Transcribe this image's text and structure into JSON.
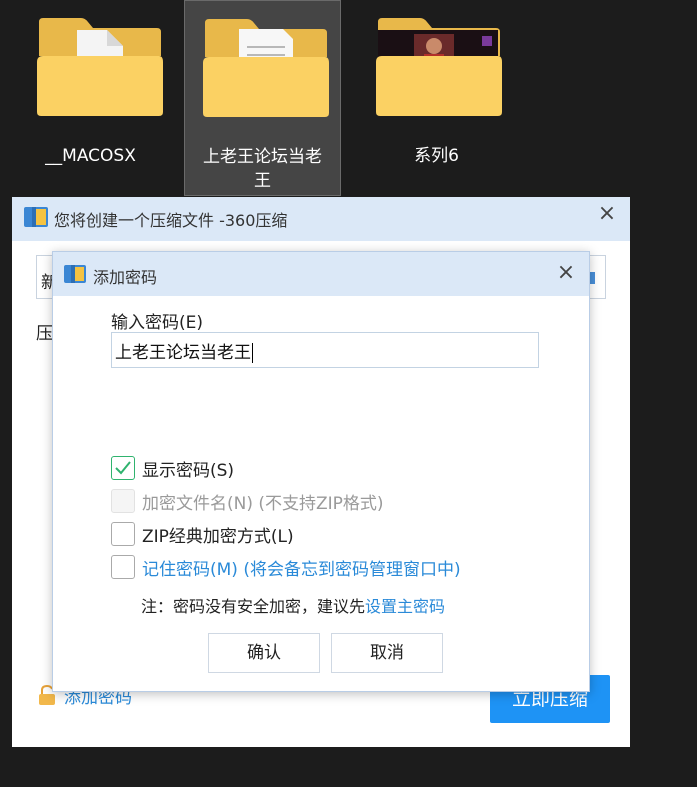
{
  "desktop": {
    "folders": [
      {
        "label": "__MACOSX",
        "icon": "folder-document-icon",
        "selected": false
      },
      {
        "label": "上老王论坛当老王",
        "icon": "folder-document-icon",
        "selected": true
      },
      {
        "label": "系列6",
        "icon": "folder-photo-icon",
        "selected": false
      }
    ]
  },
  "outer_dialog": {
    "title": "您将创建一个压缩文件 -360压缩",
    "close_icon": "×",
    "name_input_value": "新",
    "compress_label": "压",
    "add_password_label": "添加密码",
    "compress_button": "立即压缩"
  },
  "password_dialog": {
    "title": "添加密码",
    "close_icon": "×",
    "password_label": "输入密码(E)",
    "password_value": "上老王论坛当老王",
    "options": {
      "show_password": {
        "label": "显示密码(S)",
        "checked": true
      },
      "encrypt_filenames": {
        "label": "加密文件名(N) (不支持ZIP格式)",
        "checked": false,
        "disabled": true
      },
      "zip_classic": {
        "label": "ZIP经典加密方式(L)",
        "checked": false
      },
      "remember_password": {
        "label": "记住密码(M) (将会备忘到密码管理窗口中)",
        "checked": false
      }
    },
    "note_prefix": "注：密码没有安全加密，建议先",
    "note_link": "设置主密码",
    "ok_button": "确认",
    "cancel_button": "取消"
  },
  "colors": {
    "accent": "#1e93f5",
    "link": "#2a8ad8",
    "titlebar": "#dbe8f7",
    "check": "#2fb36e"
  }
}
